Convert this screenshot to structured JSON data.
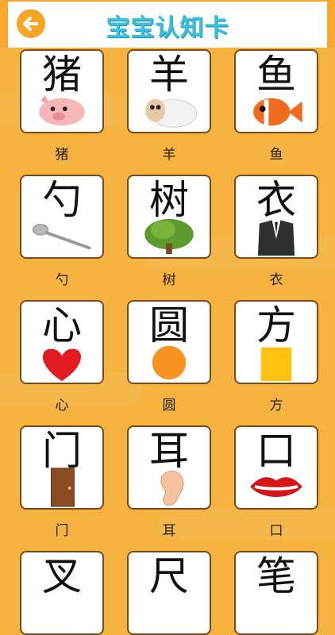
{
  "header": {
    "title": "宝宝认知卡",
    "back_icon": "arrow-left-icon"
  },
  "colors": {
    "background": "#f6b33f",
    "accent": "#f6a623",
    "title": "#3cc0de",
    "card_border": "#7a4a1c"
  },
  "cards": [
    {
      "char": "猪",
      "caption": "猪",
      "icon": "pig-icon"
    },
    {
      "char": "羊",
      "caption": "羊",
      "icon": "sheep-icon"
    },
    {
      "char": "鱼",
      "caption": "鱼",
      "icon": "fish-icon"
    },
    {
      "char": "勺",
      "caption": "勺",
      "icon": "spoon-icon"
    },
    {
      "char": "树",
      "caption": "树",
      "icon": "tree-icon"
    },
    {
      "char": "衣",
      "caption": "衣",
      "icon": "suit-icon"
    },
    {
      "char": "心",
      "caption": "心",
      "icon": "heart-icon"
    },
    {
      "char": "圆",
      "caption": "圆",
      "icon": "circle-icon"
    },
    {
      "char": "方",
      "caption": "方",
      "icon": "square-icon"
    },
    {
      "char": "门",
      "caption": "门",
      "icon": "door-icon"
    },
    {
      "char": "耳",
      "caption": "耳",
      "icon": "ear-icon"
    },
    {
      "char": "口",
      "caption": "口",
      "icon": "lips-icon"
    },
    {
      "char": "叉",
      "caption": "",
      "icon": "fork-icon"
    },
    {
      "char": "尺",
      "caption": "",
      "icon": "ruler-icon"
    },
    {
      "char": "笔",
      "caption": "",
      "icon": "pen-icon"
    }
  ]
}
